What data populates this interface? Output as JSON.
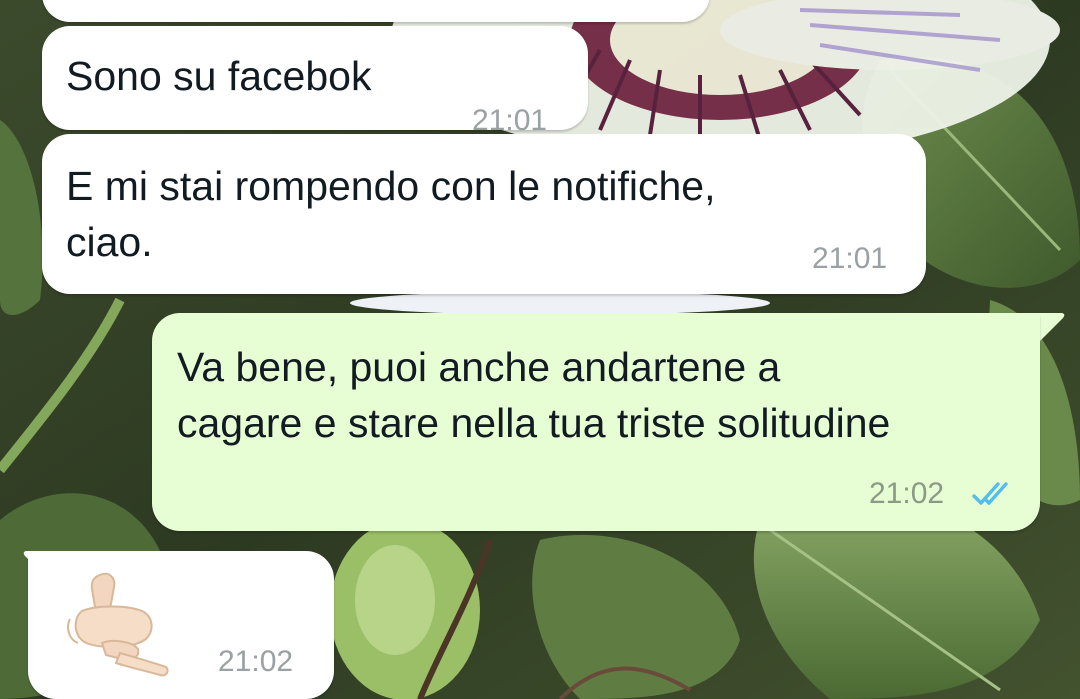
{
  "chat": {
    "messages": [
      {
        "direction": "incoming",
        "text": "",
        "time": ""
      },
      {
        "direction": "incoming",
        "text": "Sono su facebok",
        "time": "21:01"
      },
      {
        "direction": "incoming",
        "text": "E mi stai rompendo con le notifiche,\nciao.",
        "time": "21:01"
      },
      {
        "direction": "outgoing",
        "text": "Va bene, puoi anche andartene a\ncagare e stare nella tua triste solitudine",
        "time": "21:02",
        "status": "read",
        "status_icon": "double-check-icon"
      },
      {
        "direction": "incoming",
        "emoji": "call-me-hand-icon",
        "time": "21:02"
      }
    ]
  },
  "colors": {
    "incoming_bubble": "#ffffff",
    "outgoing_bubble": "#e7fdd3",
    "read_ticks": "#53bdeb",
    "text": "#111b21",
    "time": "#9aa0a3"
  }
}
